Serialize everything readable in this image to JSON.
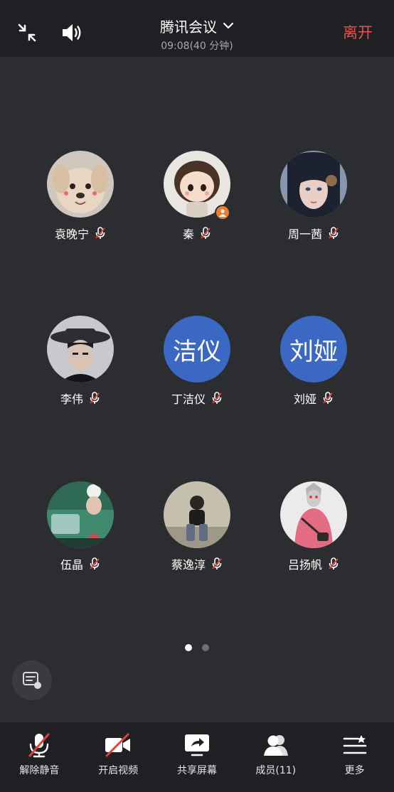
{
  "header": {
    "title": "腾讯会议",
    "time": "09:08(40 分钟)",
    "leave_label": "离开"
  },
  "participants": [
    {
      "name": "袁晚宁",
      "avatar": "photo-puppy",
      "muted": true
    },
    {
      "name": "秦",
      "avatar": "photo-cartoon-girl",
      "muted": true,
      "host": true
    },
    {
      "name": "周一茜",
      "avatar": "photo-anime-girl",
      "muted": true
    },
    {
      "name": "李伟",
      "avatar": "photo-hat-person",
      "muted": true
    },
    {
      "name": "丁洁仪",
      "avatar_text": "洁仪",
      "muted": true
    },
    {
      "name": "刘娅",
      "avatar_text": "刘娅",
      "muted": true
    },
    {
      "name": "伍晶",
      "avatar": "photo-car-person",
      "muted": true
    },
    {
      "name": "蔡逸淳",
      "avatar": "photo-sitting-person",
      "muted": true
    },
    {
      "name": "吕扬帆",
      "avatar": "photo-ultraman-person",
      "muted": true
    }
  ],
  "pagination": {
    "current": 1,
    "total": 2
  },
  "toolbar": {
    "unmute_label": "解除静音",
    "video_label": "开启视频",
    "share_label": "共享屏幕",
    "members_label": "成员(11)",
    "more_label": "更多"
  },
  "colors": {
    "background": "#2c2d30",
    "bar": "#1f2023",
    "leave": "#f0504a",
    "text_avatar": "#3a68c2",
    "mute_slash": "#e0413a",
    "host_badge": "#f07c2a"
  }
}
